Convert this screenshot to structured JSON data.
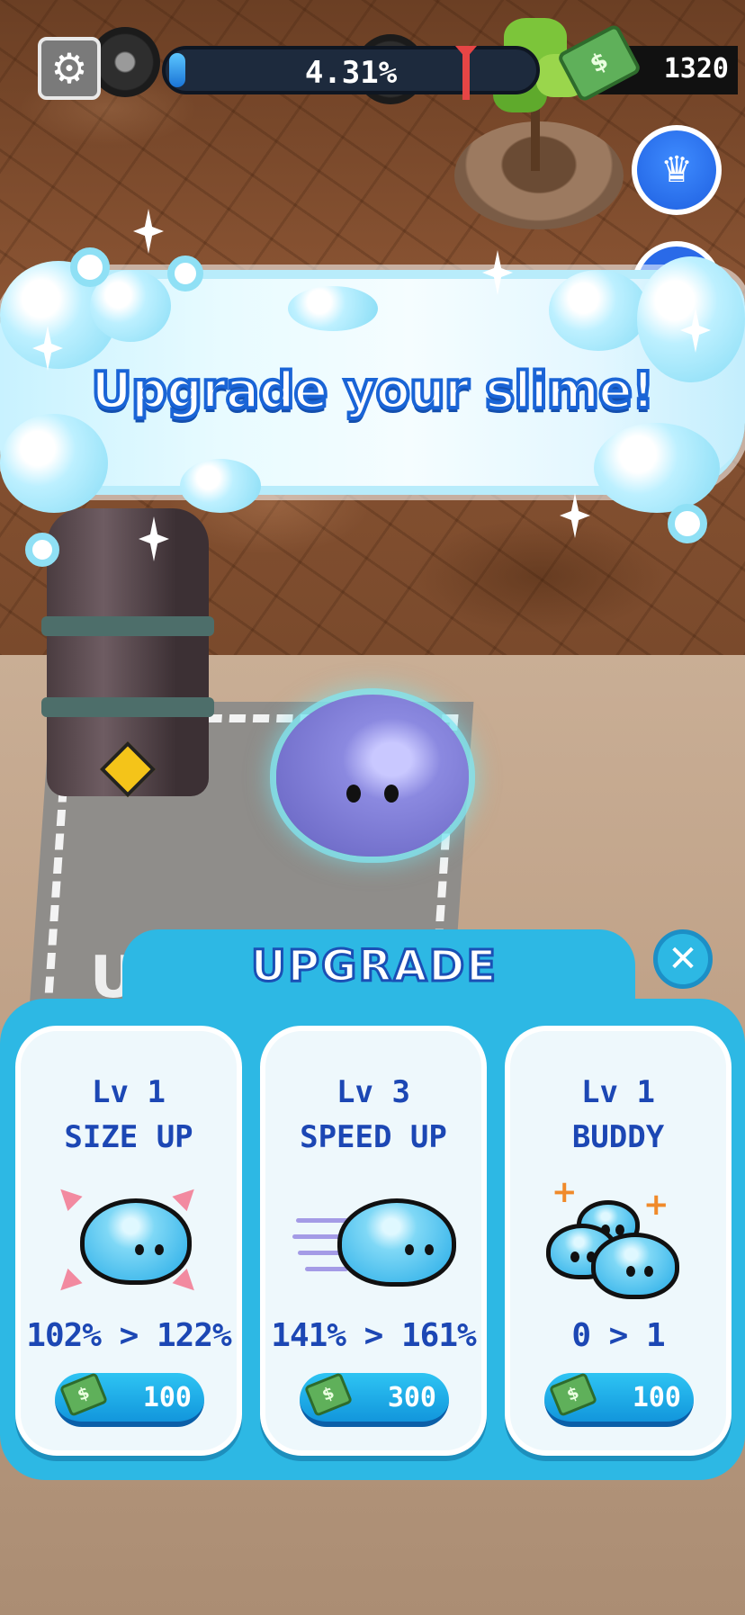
{
  "hud": {
    "progress_text": "4.31%",
    "progress_fraction": 0.0431,
    "cash": "1320",
    "settings_icon": "gear-icon",
    "cash_icon": "money-bill-icon",
    "crown_icon": "crown-slime-icon"
  },
  "banner": {
    "text": "Upgrade your slime!"
  },
  "scene": {
    "floor_text": "UPGR"
  },
  "panel": {
    "title": "UPGRADE",
    "close_icon": "close-icon",
    "cards": [
      {
        "level": "Lv 1",
        "name": "SIZE UP",
        "stat": "102% > 122%",
        "price": "100",
        "icon": "size-up-slime-icon"
      },
      {
        "level": "Lv 3",
        "name": "SPEED UP",
        "stat": "141% > 161%",
        "price": "300",
        "icon": "speed-up-slime-icon"
      },
      {
        "level": "Lv 1",
        "name": "BUDDY",
        "stat": "0 > 1",
        "price": "100",
        "icon": "buddy-slimes-icon"
      }
    ]
  },
  "colors": {
    "panel": "#2db8e4",
    "card_text": "#1c47b4",
    "banner_text_outline": "#1a64d6",
    "slime": "#7f7ddb"
  }
}
